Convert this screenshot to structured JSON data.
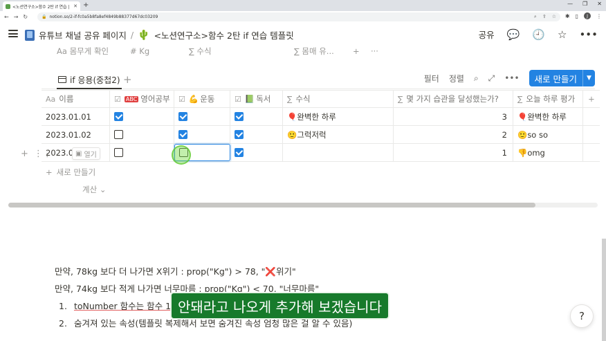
{
  "browser": {
    "tab_title": "<노션연구소>함수 2탄 if 연습 |",
    "url": "notion.so/2-if-fc0a5b8fa8ef4849b88377d67dc03209"
  },
  "topbar": {
    "breadcrumb_1": "유튜브 채널 공유 페이지",
    "breadcrumb_sep": "/",
    "breadcrumb_2": "<노션연구소>함수 2탄 if 연습 템플릿",
    "share": "공유"
  },
  "prev_header": [
    "Aa 몸무게 확인",
    "# Kg",
    "∑ 수식",
    "∑ 몸매 유...",
    "+",
    "···"
  ],
  "view": {
    "tab_label": "if 응용(중첩2)",
    "filter": "필터",
    "sort": "정렬",
    "new_button": "새로 만들기"
  },
  "table": {
    "headers": [
      {
        "icon": "Aa",
        "label": "이름"
      },
      {
        "icon": "☑",
        "label": "영어공부"
      },
      {
        "icon": "☑",
        "label": "운동"
      },
      {
        "icon": "☑",
        "label": "독서"
      },
      {
        "icon": "∑",
        "label": "수식"
      },
      {
        "icon": "∑",
        "label": "몇 가지 습관을 달성했는가?"
      },
      {
        "icon": "∑",
        "label": "오늘 하루 평가"
      }
    ],
    "rows": [
      {
        "name": "2023.01.01",
        "english": true,
        "exercise": true,
        "reading": true,
        "formula": "🎈완벽한 하루",
        "count": "3",
        "rating": "🎈완벽한 하루"
      },
      {
        "name": "2023.01.02",
        "english": false,
        "exercise": true,
        "reading": true,
        "formula": "🙂그럭저럭",
        "count": "2",
        "rating": "🙂so so"
      },
      {
        "name": "2023.01",
        "english": false,
        "exercise": false,
        "reading": true,
        "formula": "",
        "count": "1",
        "rating": "👎omg"
      }
    ],
    "open_label": "열기",
    "add_row": "새로 만들기",
    "calc": "계산"
  },
  "body": {
    "line1": "만약, 78kg 보다 더 나가면 X위기 : prop(\"Kg\") > 78, \"❌위기\"",
    "line2": "만약, 74kg 보다 적게 나가면 너무마름 : prop(\"Kg\") < 70, \"너무마름\"",
    "li1_num": "1.",
    "li1_text": "toNumber 함수는 함수 1탄",
    "li2_num": "2.",
    "li2_text": "숨겨져 있는 속성(템플릿 복제해서 보면 숨겨진 속성 엄청 많은 걸 알 수 있음)"
  },
  "caption": "안돼라고 나오게 추가해 보겠습니다",
  "help": "?",
  "colors": {
    "accent": "#2383e2",
    "caption_bg": "#177a2b"
  }
}
